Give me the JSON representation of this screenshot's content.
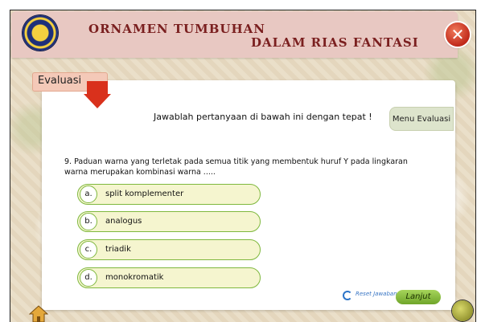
{
  "header": {
    "title_line1": "ORNAMEN TUMBUHAN",
    "title_line2": "DALAM RIAS FANTASI",
    "close_icon": "close-icon"
  },
  "section_tab": {
    "label": "Evaluasi"
  },
  "instruction": "Jawablah pertanyaan di bawah ini dengan tepat !",
  "menu_button": "Menu Evaluasi",
  "question": {
    "text": "9.  Paduan warna yang terletak pada semua titik yang membentuk huruf Y pada lingkaran warna merupakan kombinasi warna ....."
  },
  "options": [
    {
      "letter": "a.",
      "text": "split komplementer"
    },
    {
      "letter": "b.",
      "text": "analogus"
    },
    {
      "letter": "c.",
      "text": "triadik"
    },
    {
      "letter": "d.",
      "text": "monokromatik"
    }
  ],
  "footer": {
    "reset_label": "Reset Jawaban",
    "next_label": "Lanjut",
    "home_icon": "home-icon",
    "speaker_icon": "speaker-icon"
  },
  "colors": {
    "header_bg": "#e8c8c2",
    "title_color": "#7a1f1f",
    "close_red": "#c0291b",
    "option_border": "#7fb83e",
    "option_fill": "#f5f5cf",
    "next_green": "#8cc043"
  }
}
